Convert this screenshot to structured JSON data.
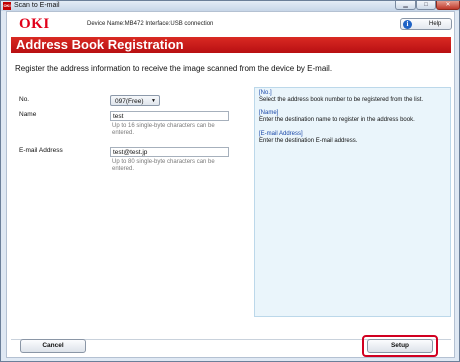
{
  "window": {
    "app_icon_text": "OKI",
    "title": "Scan to E-mail"
  },
  "header": {
    "logo": "OKI",
    "device_info": "Device Name:MB472  Interface:USB connection",
    "help_label": "Help"
  },
  "page": {
    "title": "Address Book Registration",
    "intro": "Register the address information to receive the image scanned from the device by E-mail."
  },
  "form": {
    "no_label": "No.",
    "no_value": "097(Free)",
    "name_label": "Name",
    "name_value": "test",
    "name_hint": "Up to 16 single-byte characters can be entered.",
    "email_label": "E-mail Address",
    "email_value": "test@test.jp",
    "email_hint": "Up to 80 single-byte characters can be entered."
  },
  "help_panel": {
    "no_head": "[No.]",
    "no_text": "Select the address book number to be registered from the list.",
    "name_head": "[Name]",
    "name_text": "Enter the destination name to register in the address book.",
    "email_head": "[E-mail Address]",
    "email_text": "Enter the destination E-mail address."
  },
  "footer": {
    "cancel_label": "Cancel",
    "setup_label": "Setup"
  },
  "colors": {
    "brand_red": "#e1001a",
    "banner_red": "#c8161b",
    "help_blue": "#1f63c6"
  }
}
